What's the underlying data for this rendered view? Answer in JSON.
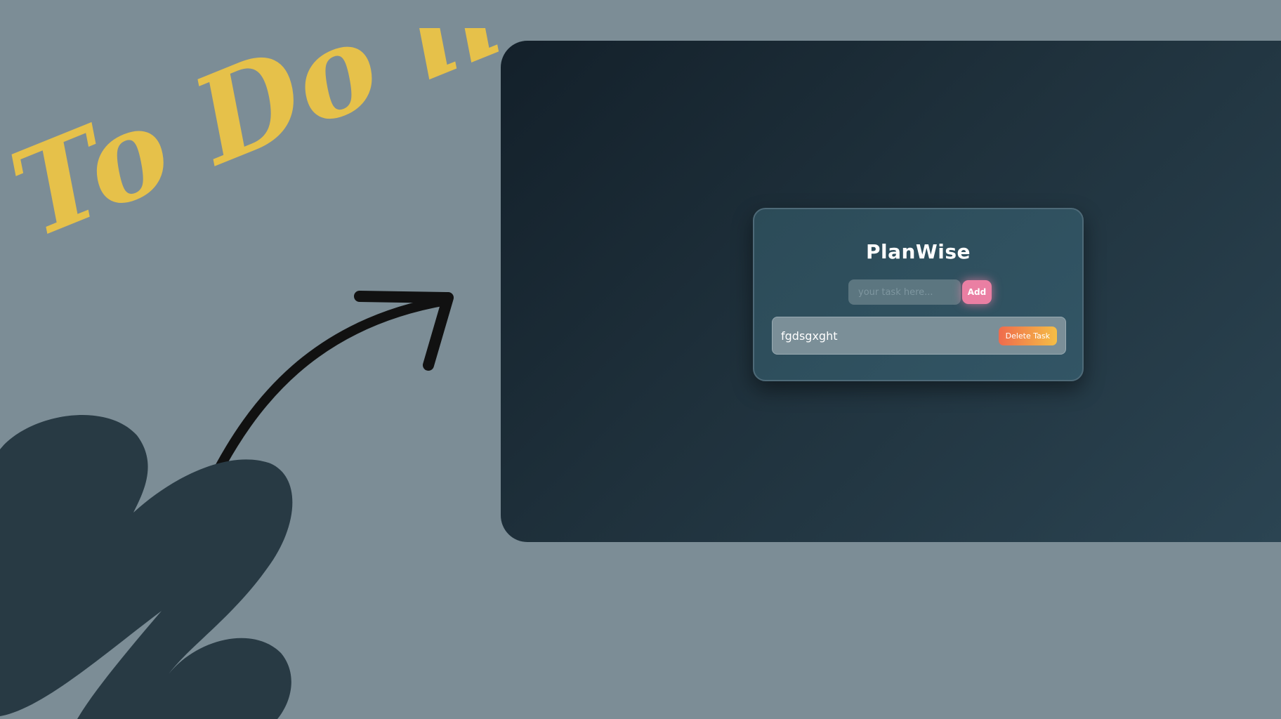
{
  "decoration": {
    "headline_text": "To Do list",
    "headline_color": "#e6c14a",
    "arrow_color": "#111111",
    "blob_color": "#283a44"
  },
  "app": {
    "title": "PlanWise",
    "input": {
      "value": "",
      "placeholder": "your task here..."
    },
    "add_button_label": "Add",
    "tasks": [
      {
        "text": "fgdsgxght",
        "delete_label": "Delete Task"
      }
    ]
  },
  "colors": {
    "background": "#7c8d96",
    "add_button": "#ea7fa3",
    "delete_gradient_start": "#ef6b4d",
    "delete_gradient_end": "#f5be45"
  }
}
